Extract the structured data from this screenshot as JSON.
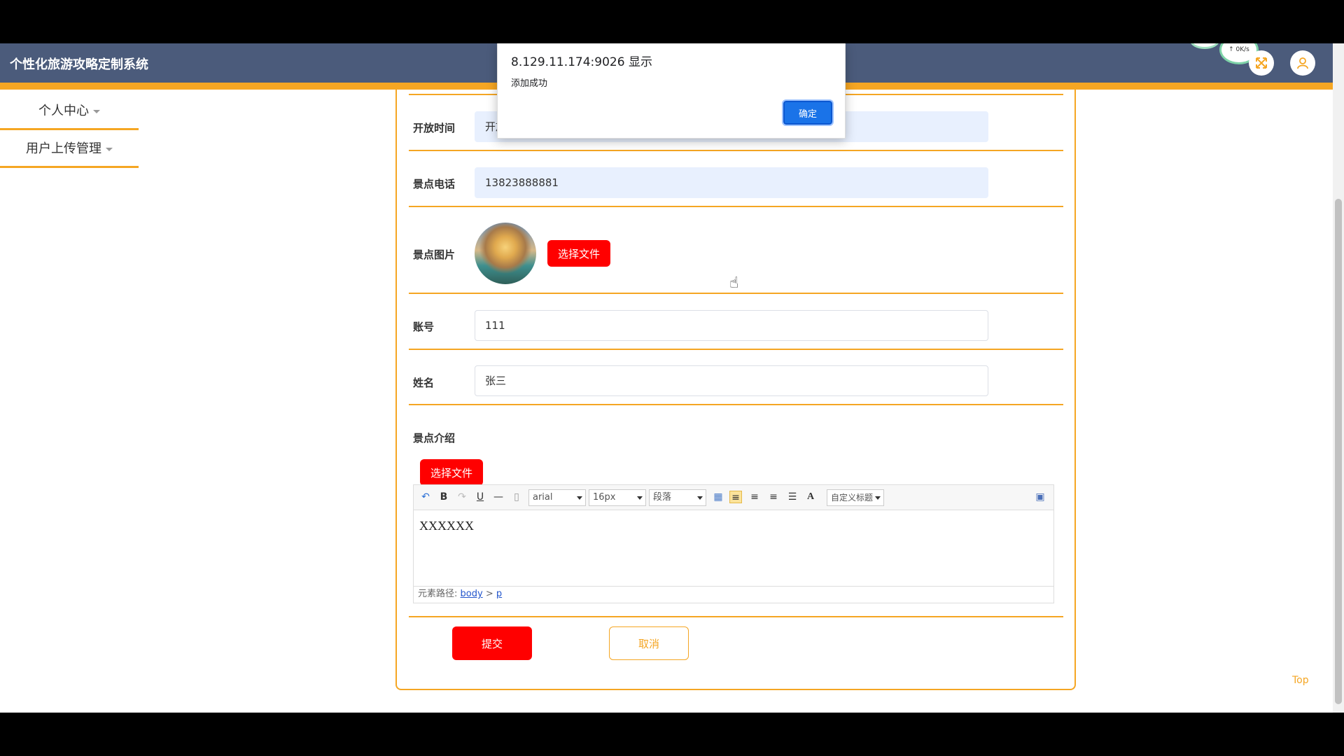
{
  "header": {
    "title": "个性化旅游攻略定制系统",
    "speed": "↑ 0K/s",
    "colors": {
      "bar": "#4b5b7b",
      "accent": "#f5a623"
    }
  },
  "sidebar": {
    "items": [
      {
        "label": "个人中心"
      },
      {
        "label": "用户上传管理"
      }
    ]
  },
  "form": {
    "open_time": {
      "label": "开放时间",
      "value": "开放"
    },
    "phone": {
      "label": "景点电话",
      "value": "13823888881"
    },
    "image": {
      "label": "景点图片",
      "button": "选择文件"
    },
    "account": {
      "label": "账号",
      "value": "111"
    },
    "name": {
      "label": "姓名",
      "value": "张三"
    },
    "intro": {
      "label": "景点介绍",
      "button": "选择文件"
    },
    "submit": "提交",
    "cancel": "取消"
  },
  "editor": {
    "font": "arial",
    "size": "16px",
    "paragraph": "段落",
    "custom_title": "自定义标题",
    "content": "XXXXXX",
    "path_label": "元素路径:",
    "path_body": "body",
    "path_sep": ">",
    "path_p": "p"
  },
  "dialog": {
    "title": "8.129.11.174:9026 显示",
    "message": "添加成功",
    "ok": "确定"
  },
  "footer": {
    "top": "Top"
  }
}
